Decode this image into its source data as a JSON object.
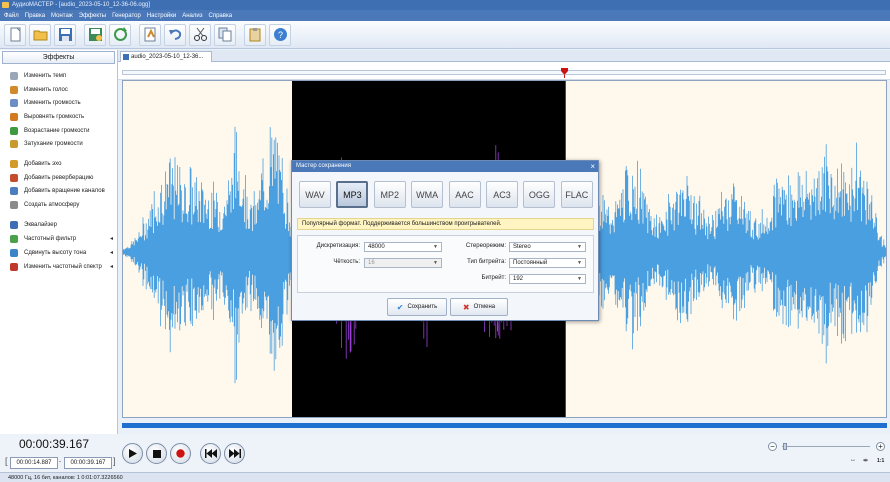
{
  "window": {
    "title": "АудиоМАСТЕР - [audio_2023-05-10_12-36-06.ogg]"
  },
  "menu": [
    "Файл",
    "Правка",
    "Монтаж",
    "Эффекты",
    "Генератор",
    "Настройки",
    "Анализ",
    "Справка"
  ],
  "toolbar": {
    "icons": [
      "new-file-icon",
      "open-folder-icon",
      "save-icon",
      "save-as-icon",
      "refresh-icon",
      "undo-history-icon",
      "undo-icon",
      "cut-icon",
      "copy-icon",
      "paste-icon",
      "help-icon"
    ]
  },
  "effects": {
    "tab_label": "Эффекты",
    "items": [
      {
        "label": "Изменить темп",
        "color": "#9aa7b8",
        "submenu": false
      },
      {
        "label": "Изменить голос",
        "color": "#d08a2a",
        "submenu": false
      },
      {
        "label": "Изменить громкость",
        "color": "#6b8fc4",
        "submenu": false
      },
      {
        "label": "Выровнять громкость",
        "color": "#d47a1e",
        "submenu": false
      },
      {
        "label": "Возрастание громкости",
        "color": "#3f9a3f",
        "submenu": false
      },
      {
        "label": "Затухание громкости",
        "color": "#c9982f",
        "submenu": false
      },
      {
        "label": "Добавить эхо",
        "color": "#d19a2a",
        "submenu": false
      },
      {
        "label": "Добавить реверберацию",
        "color": "#c44c2c",
        "submenu": false
      },
      {
        "label": "Добавить вращение каналов",
        "color": "#4a7ebf",
        "submenu": false
      },
      {
        "label": "Создать атмосферу",
        "color": "#8b8b8b",
        "submenu": false
      },
      {
        "label": "Эквалайзер",
        "color": "#3c6fb4",
        "submenu": false
      },
      {
        "label": "Частотный фильтр",
        "color": "#4aa14a",
        "submenu": true
      },
      {
        "label": "Сдвинуть высоту тона",
        "color": "#3b86c9",
        "submenu": true
      },
      {
        "label": "Изменить частотный спектр",
        "color": "#c0392b",
        "submenu": true
      }
    ]
  },
  "document": {
    "tab_label": "audio_2023-05-10_12-36..."
  },
  "dialog": {
    "title": "Мастер сохранения",
    "formats": [
      "WAV",
      "MP3",
      "MP2",
      "WMA",
      "AAC",
      "AC3",
      "OGG",
      "FLAC"
    ],
    "selected_format": "MP3",
    "description": "Популярный формат. Поддерживается большинством проигрывателей.",
    "fields": {
      "sample_rate": {
        "label": "Дискретизация:",
        "value": "48000"
      },
      "clarity": {
        "label": "Чёткость:",
        "value": "16"
      },
      "stereo_mode": {
        "label": "Стереорежим:",
        "value": "Stereo"
      },
      "bitrate_type": {
        "label": "Тип битрейта:",
        "value": "Постоянный"
      },
      "bitrate": {
        "label": "Битрейт:",
        "value": "192"
      }
    },
    "save_label": "Сохранить",
    "cancel_label": "Отмена"
  },
  "playback": {
    "current_time": "00:00:39.167",
    "selection_start": "00:00:14.887",
    "selection_end": "00:00:39.167",
    "separator": "-",
    "progress_fraction": 1.0,
    "zoom_labels": {
      "minus": "−",
      "plus": "+"
    },
    "fit_label": "1:1"
  },
  "status": {
    "text": "48000 Гц, 16 бит, каналов: 1     0:01:07.3226560"
  },
  "colors": {
    "waveform": "#4a9fe0",
    "waveform_selected": "#9b3fd6",
    "selection_bg": "#000000",
    "wave_bg": "#fff8ec",
    "accent": "#4a78b8",
    "playhead": "#cc1111"
  }
}
